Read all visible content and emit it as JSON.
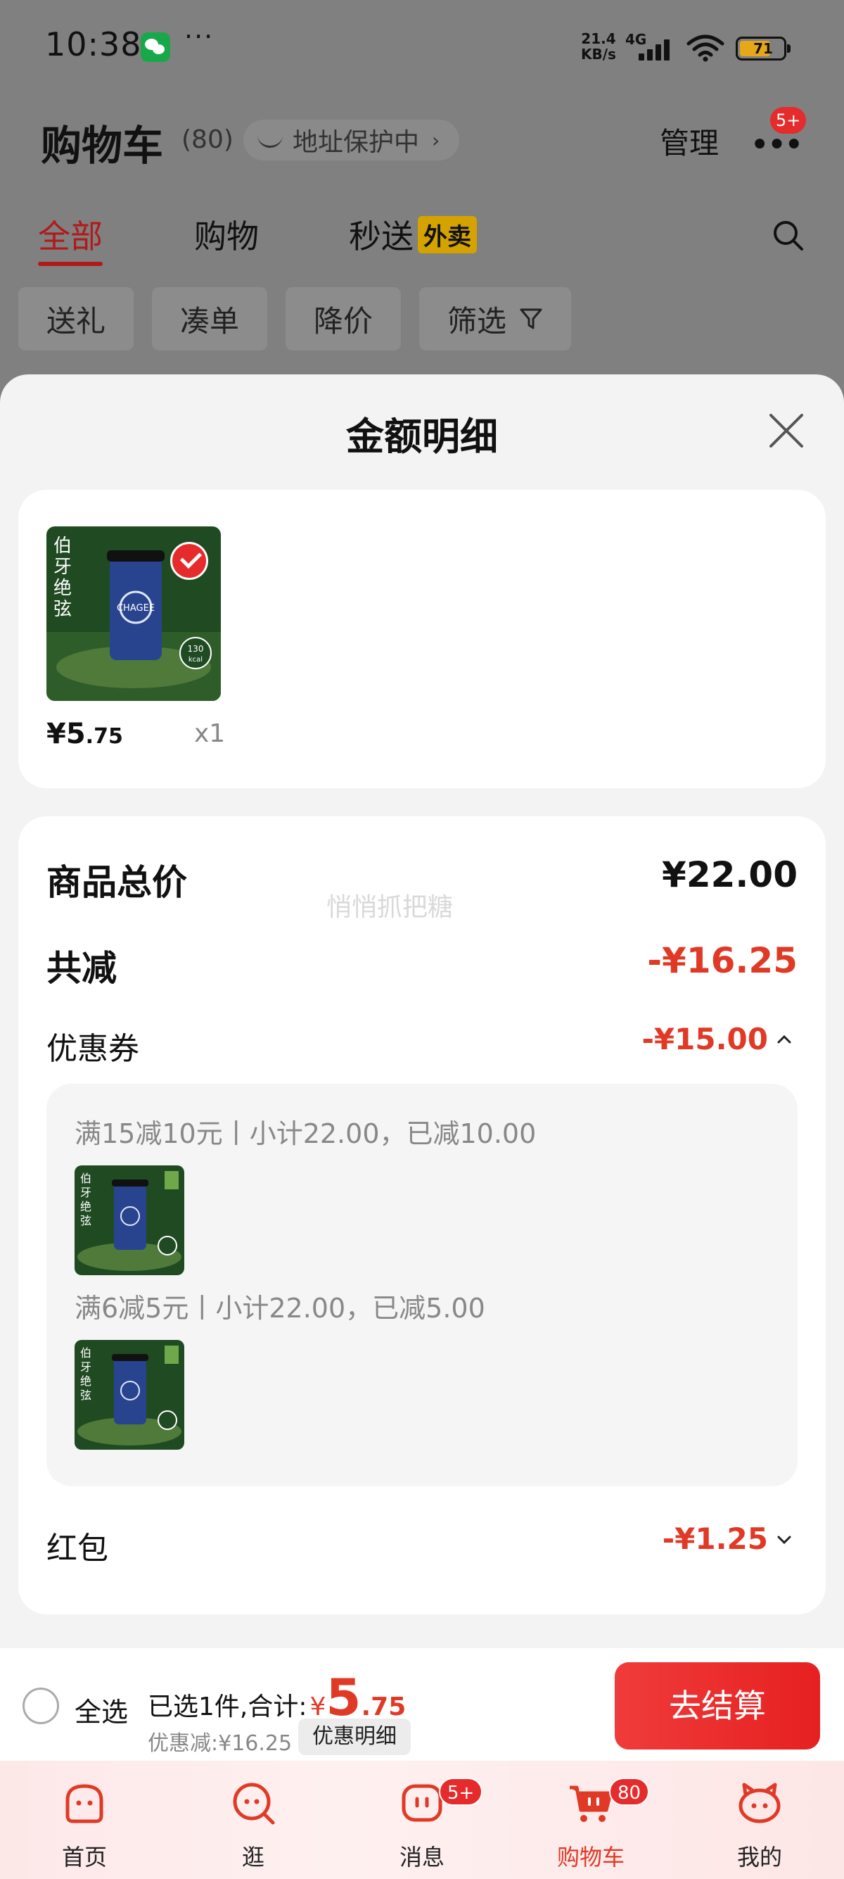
{
  "status_bar": {
    "time": "10:38",
    "net_speed_value": "21.4",
    "net_speed_unit": "KB/s",
    "network": "4G",
    "battery": "71",
    "more": "···"
  },
  "header": {
    "title": "购物车",
    "count": "(80)",
    "address_protection": "地址保护中",
    "manage": "管理",
    "more_badge": "5+"
  },
  "tabs": [
    {
      "label": "全部",
      "active": true
    },
    {
      "label": "购物",
      "active": false
    },
    {
      "label": "秒送",
      "badge": "外卖",
      "active": false
    }
  ],
  "chips": [
    "送礼",
    "凑单",
    "降价",
    "筛选"
  ],
  "sheet": {
    "title": "金额明细",
    "product": {
      "price_int": "¥5",
      "price_dec": ".75",
      "quantity": "x1",
      "image_text": "伯牙绝弦",
      "image_kcal": "130",
      "image_kcal_unit": "kcal",
      "image_brand": "CHAGEE"
    },
    "summary": {
      "total_label": "商品总价",
      "total_value": "¥22.00",
      "reduce_label": "共减",
      "reduce_value": "-¥16.25",
      "coupon_label": "优惠券",
      "coupon_value": "-¥15.00",
      "coupons": [
        {
          "text": "满15减10元丨小计22.00，已减10.00"
        },
        {
          "text": "满6减5元丨小计22.00，已减5.00"
        }
      ],
      "redpacket_label": "红包",
      "redpacket_value": "-¥1.25",
      "watermark": "悄悄抓把糖"
    }
  },
  "action_bar": {
    "select_all": "全选",
    "selected_text": "已选1件,合计:",
    "yen": "¥",
    "total_int": "5",
    "total_dec": ".75",
    "discount": "优惠减:¥16.25",
    "detail_button": "优惠明细",
    "checkout": "去结算"
  },
  "tabbar": [
    {
      "label": "首页",
      "icon": "home-icon"
    },
    {
      "label": "逛",
      "icon": "browse-icon"
    },
    {
      "label": "消息",
      "icon": "message-icon",
      "badge": "5+"
    },
    {
      "label": "购物车",
      "icon": "cart-icon",
      "badge": "80",
      "active": true
    },
    {
      "label": "我的",
      "icon": "profile-icon"
    }
  ],
  "colors": {
    "accent_red": "#e03a26",
    "tab_active": "#b01a1a",
    "battery": "#e6a818",
    "delivery_badge": "#d4a300"
  }
}
